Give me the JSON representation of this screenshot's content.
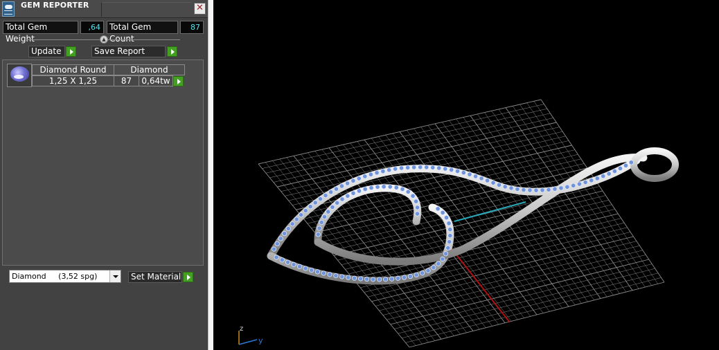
{
  "window": {
    "title": "GEM REPORTER",
    "close_label": "✕"
  },
  "summary": {
    "weight_label": "Total Gem Weight",
    "weight_value": ",64",
    "count_label": "Total Gem Count",
    "count_value": "87"
  },
  "buttons": {
    "update": "Update",
    "save_report": "Save Report",
    "set_material": "Set Material"
  },
  "gem_table": {
    "headers": [
      "Diamond Round",
      "Diamond"
    ],
    "row": {
      "size": "1,25 X 1,25",
      "count": "87",
      "weight": "0,64tw"
    }
  },
  "material": {
    "selected": "Diamond     (3,52 spg)"
  },
  "viewport": {
    "axis_labels": {
      "z": "z",
      "y": "y"
    }
  },
  "colors": {
    "panel_bg": "#424242",
    "accent_green": "#44a022",
    "value_text": "#5ee0ea",
    "grid": "#8c8c8c",
    "axis_x": "#b01010",
    "axis_y": "#2aa9b8",
    "gem_blue": "#6f93d8"
  }
}
